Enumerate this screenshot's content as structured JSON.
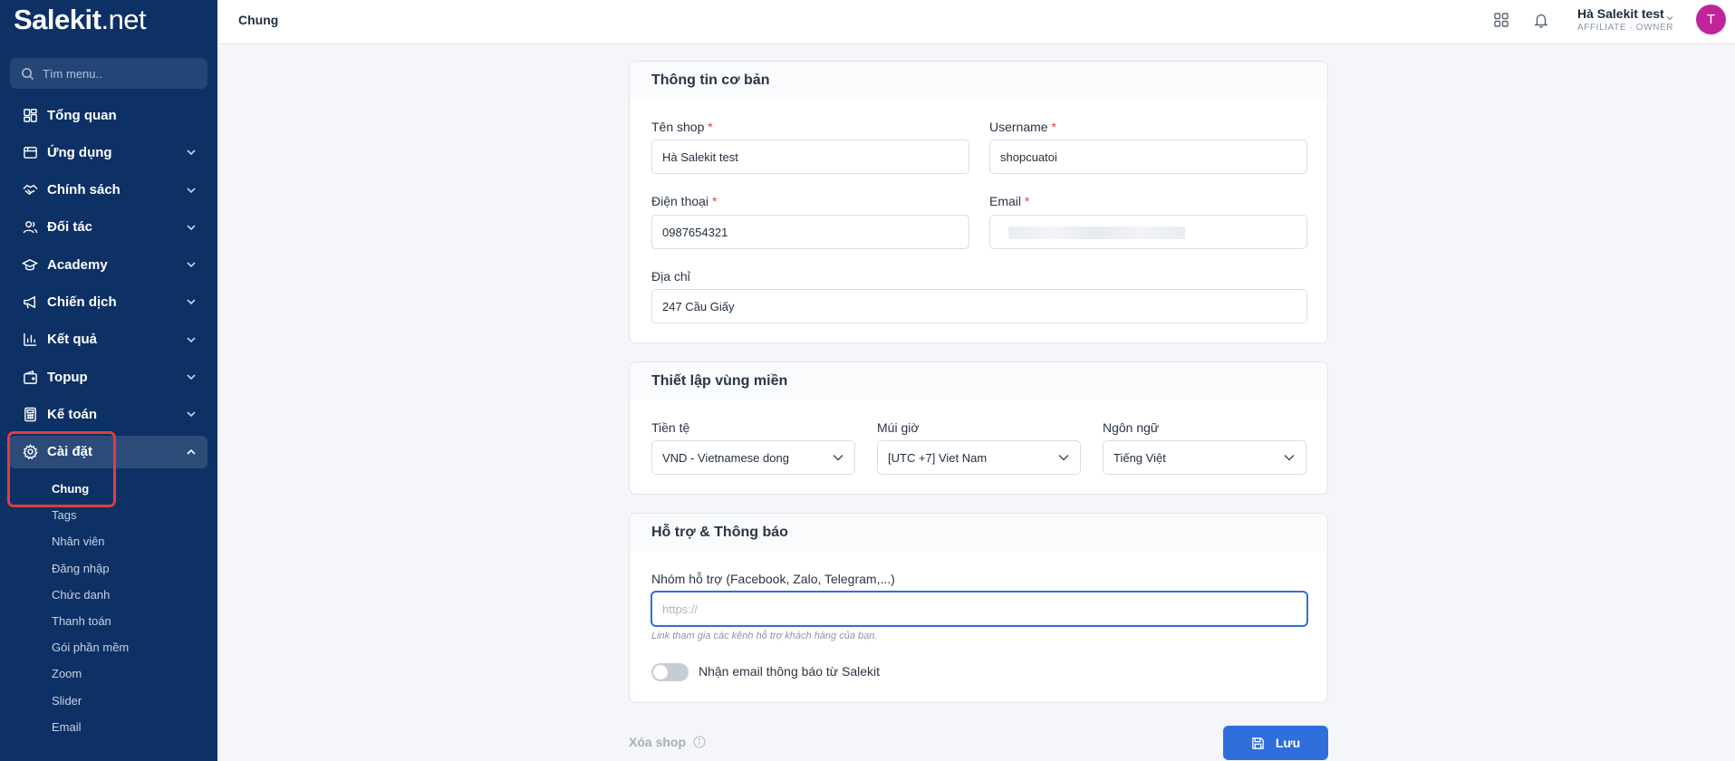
{
  "brand": {
    "logo_main": "Salekit",
    "logo_suffix": ".net"
  },
  "sidebar": {
    "search_placeholder": "Tìm menu..",
    "items": [
      {
        "label": "Tổng quan",
        "icon": "dashboard-icon",
        "has_chevron": false
      },
      {
        "label": "Ứng dụng",
        "icon": "app-window-icon",
        "has_chevron": true
      },
      {
        "label": "Chính sách",
        "icon": "handshake-icon",
        "has_chevron": true
      },
      {
        "label": "Đối tác",
        "icon": "users-icon",
        "has_chevron": true
      },
      {
        "label": "Academy",
        "icon": "graduation-cap-icon",
        "has_chevron": true
      },
      {
        "label": "Chiến dịch",
        "icon": "megaphone-icon",
        "has_chevron": true
      },
      {
        "label": "Kết quả",
        "icon": "bar-chart-icon",
        "has_chevron": true
      },
      {
        "label": "Topup",
        "icon": "wallet-icon",
        "has_chevron": true
      },
      {
        "label": "Kế toán",
        "icon": "calculator-icon",
        "has_chevron": true
      },
      {
        "label": "Cài đặt",
        "icon": "gear-icon",
        "has_chevron": true,
        "expanded": true,
        "active": true
      }
    ],
    "subitems": [
      {
        "label": "Chung",
        "active": true
      },
      {
        "label": "Tags"
      },
      {
        "label": "Nhân viên"
      },
      {
        "label": "Đăng nhập"
      },
      {
        "label": "Chức danh"
      },
      {
        "label": "Thanh toán"
      },
      {
        "label": "Gói phần mềm"
      },
      {
        "label": "Zoom"
      },
      {
        "label": "Slider"
      },
      {
        "label": "Email"
      }
    ],
    "highlight_color": "#e33d3d"
  },
  "header": {
    "title": "Chung",
    "user_name": "Hà Salekit test",
    "user_role": "AFFILIATE · OWNER",
    "avatar_letter": "T",
    "avatar_color": "#c0249b"
  },
  "basic_info": {
    "title": "Thông tin cơ bản",
    "shop_name_label": "Tên shop",
    "shop_name_value": "Hà Salekit test",
    "username_label": "Username",
    "username_value": "shopcuatoi",
    "phone_label": "Điện thoại",
    "phone_value": "0987654321",
    "email_label": "Email",
    "address_label": "Địa chỉ",
    "address_value": "247 Cầu Giấy",
    "required_mark": "*"
  },
  "region": {
    "title": "Thiết lập vùng miền",
    "currency_label": "Tiền tệ",
    "currency_value": "VND - Vietnamese dong",
    "timezone_label": "Múi giờ",
    "timezone_value": "[UTC +7] Viet Nam",
    "language_label": "Ngôn ngữ",
    "language_value": "Tiếng Việt"
  },
  "support": {
    "title": "Hỗ trợ & Thông báo",
    "group_label": "Nhóm hỗ trợ (Facebook, Zalo, Telegram,...)",
    "group_placeholder": "https://",
    "group_help": "Link tham gia các kênh hỗ trợ khách hàng của bạn.",
    "email_notify_label": "Nhận email thông báo từ Salekit",
    "email_notify_on": false
  },
  "footer": {
    "delete_label": "Xóa shop",
    "save_label": "Lưu",
    "accent_color": "#2f6fdc"
  }
}
